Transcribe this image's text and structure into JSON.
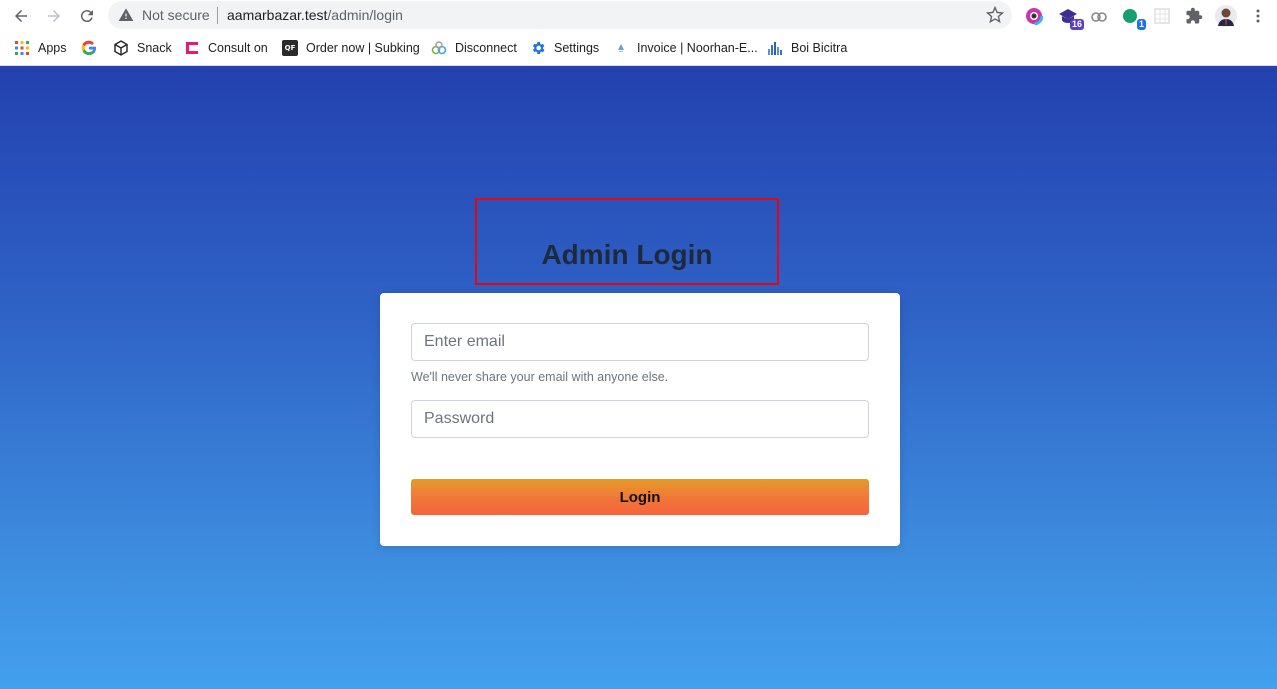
{
  "browser": {
    "omnibox": {
      "security_label": "Not secure",
      "url_host": "aamarbazar.test",
      "url_path": "/admin/login"
    },
    "extensions": [
      {
        "name": "colorzilla-icon"
      },
      {
        "name": "graduation-cap-icon",
        "badge": "16"
      },
      {
        "name": "link-icon"
      },
      {
        "name": "grammarly-icon",
        "badge": "1"
      },
      {
        "name": "grid-extension-icon"
      },
      {
        "name": "puzzle-icon"
      },
      {
        "name": "profile-avatar"
      }
    ]
  },
  "bookmarks": [
    {
      "label": "Apps",
      "icon": "apps-grid-icon"
    },
    {
      "label": "",
      "icon": "google-icon"
    },
    {
      "label": "Snack",
      "icon": "snack-cube-icon"
    },
    {
      "label": "Consult on",
      "icon": "consult-icon"
    },
    {
      "label": "Order now | Subking",
      "icon": "qf-icon"
    },
    {
      "label": "Disconnect",
      "icon": "disconnect-icon"
    },
    {
      "label": "Settings",
      "icon": "gear-icon"
    },
    {
      "label": "Invoice | Noorhan-E...",
      "icon": "invoice-icon"
    },
    {
      "label": "Boi Bicitra",
      "icon": "boi-bicitra-icon"
    }
  ],
  "page": {
    "title": "Admin Login",
    "email_placeholder": "Enter email",
    "email_hint": "We'll never share your email with anyone else.",
    "password_placeholder": "Password",
    "login_button": "Login"
  },
  "colors": {
    "highlight_border": "#e30613",
    "background_top": "#2341b0",
    "background_bottom": "#43a0ee",
    "button_top": "#e49b26",
    "button_bottom": "#f4633c"
  }
}
